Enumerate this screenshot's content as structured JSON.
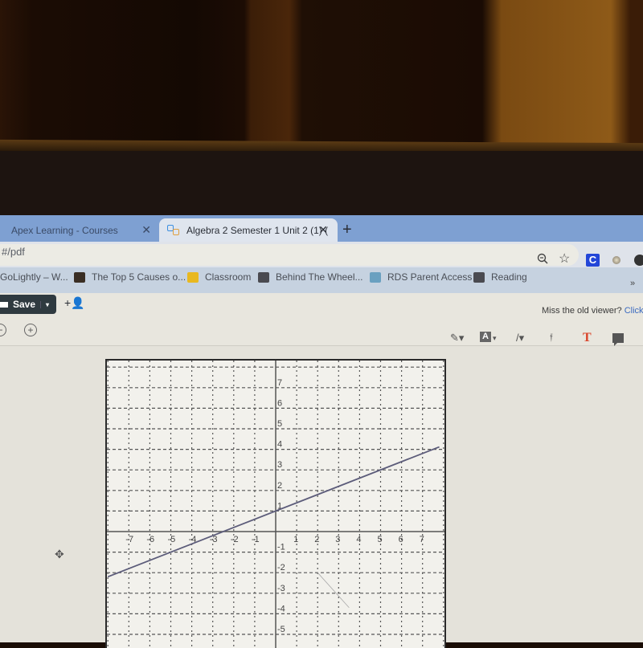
{
  "browser": {
    "tabs": [
      {
        "label": "Apex Learning - Courses",
        "active": false,
        "close": "✕"
      },
      {
        "label": "Algebra 2 Semester 1 Unit 2 (1) (",
        "active": true,
        "close": "✕"
      }
    ],
    "new_tab": "+",
    "url": "#/pdf",
    "bookmarks": [
      {
        "label": "GoLightly – W...",
        "icon": "page-icon",
        "color": "#c6d2e0"
      },
      {
        "label": "The Top 5 Causes o...",
        "icon": "co-icon",
        "color": "#3a2e24"
      },
      {
        "label": "Classroom",
        "icon": "classroom-icon",
        "color": "#e8b820"
      },
      {
        "label": "Behind The Wheel...",
        "icon": "book-icon",
        "color": "#4a4a50"
      },
      {
        "label": "RDS Parent Access",
        "icon": "rds-icon",
        "color": "#6aa0c0"
      },
      {
        "label": "Reading",
        "icon": "book-icon",
        "color": "#4a4a50"
      }
    ],
    "bookmarks_more": "»",
    "extensions": {
      "c_label": "C"
    }
  },
  "pdf_toolbar": {
    "save_label": "Save",
    "dropdown": "▾",
    "add_user": "+👤",
    "miss_text": "Miss the old viewer?",
    "miss_link": "Click",
    "zoom_in": "+",
    "zoom_out": "−",
    "tools": {
      "highlighter": "✎▾",
      "text_box": "A",
      "text_box_caret": "▾",
      "line": "/▾",
      "signature": "𝔣",
      "text": "T"
    }
  },
  "chart_data": {
    "type": "line",
    "title": "",
    "xlabel": "",
    "ylabel": "",
    "grid": true,
    "xlim": [
      -8,
      8
    ],
    "ylim": [
      -5,
      8
    ],
    "x_ticks": [
      "-7",
      "-6",
      "-5",
      "-4",
      "-3",
      "-2",
      "-1",
      "1",
      "2",
      "3",
      "4",
      "5",
      "6",
      "7"
    ],
    "y_ticks": [
      "7",
      "6",
      "5",
      "4",
      "3",
      "2",
      "1",
      "-1",
      "-2",
      "-3",
      "-4",
      "-5"
    ],
    "series": [
      {
        "name": "line",
        "equation": "y = 0.4x + 1",
        "slope": 0.4,
        "intercept": 1,
        "x": [
          -8,
          7.8
        ],
        "y": [
          -2.2,
          4.12
        ]
      }
    ]
  }
}
